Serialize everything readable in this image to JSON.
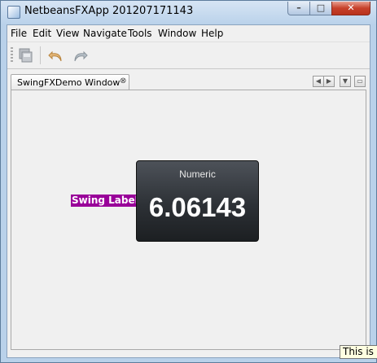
{
  "window": {
    "title": "NetbeansFXApp 201207171143",
    "minimize_glyph": "–",
    "maximize_glyph": "□",
    "close_glyph": "✕"
  },
  "menubar": {
    "items": [
      {
        "label": "File"
      },
      {
        "label": "Edit"
      },
      {
        "label": "View"
      },
      {
        "label": "Navigate"
      },
      {
        "label": "Tools"
      },
      {
        "label": "Window"
      },
      {
        "label": "Help"
      }
    ]
  },
  "toolbar": {
    "icons": [
      "save-all-icon",
      "undo-icon",
      "redo-icon"
    ]
  },
  "editor": {
    "tab_label": "SwingFXDemo Window",
    "tab_close_glyph": "⊗",
    "scroll_left_glyph": "◀",
    "scroll_right_glyph": "▶",
    "dropdown_glyph": "▼",
    "maximize_glyph": "▭",
    "swing_label": "Swing Label",
    "lcd": {
      "title": "Numeric",
      "value": "6.06143"
    }
  },
  "tooltip": {
    "text": "This is a"
  },
  "colors": {
    "swing_label_bg": "#990099",
    "lcd_bg": "#2d3136"
  }
}
